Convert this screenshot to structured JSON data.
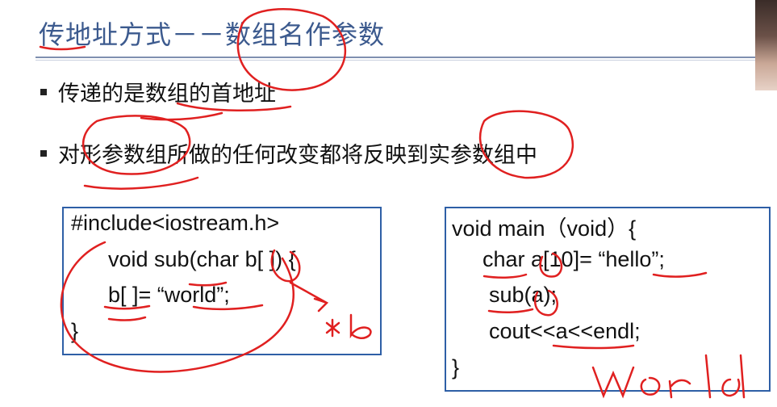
{
  "slide": {
    "title": "传地址方式－－数组名作参数",
    "bullets": [
      "传递的是数组的首地址",
      "对形参数组所做的任何改变都将反映到实参数组中"
    ]
  },
  "left_code": {
    "lines": [
      "#include<iostream.h>",
      "void sub(char b[ ]) {",
      "b[ ]= “world”;",
      "}"
    ]
  },
  "right_code": {
    "lines": [
      "void main（void）{",
      "char a[10]= “hello”;",
      "sub(a);",
      "cout<<a<<endl;",
      "}"
    ]
  },
  "colors": {
    "title": "#3c5a8e",
    "box_border": "#2e5fa6",
    "annotation_ink": "#e02020"
  },
  "icons": [
    "bullet-square-icon"
  ],
  "webcam": {
    "visible": true
  }
}
